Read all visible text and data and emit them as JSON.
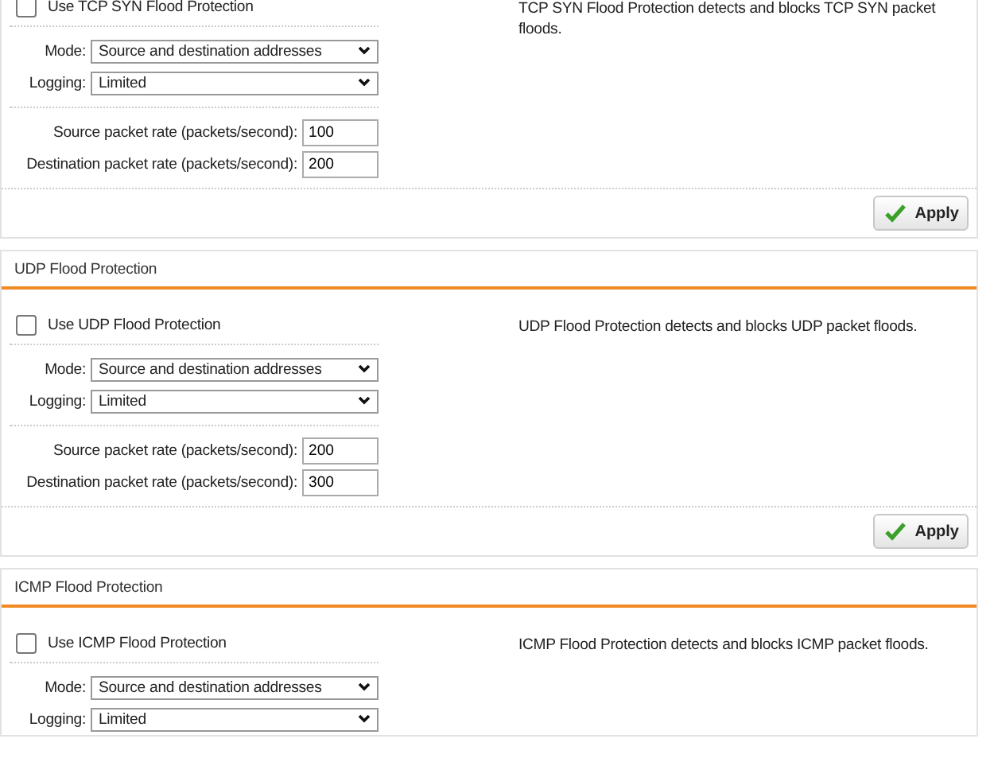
{
  "sections": [
    {
      "checkbox": {
        "label": "Use TCP SYN Flood Protection",
        "checked": false
      },
      "description": "TCP SYN Flood Protection detects and blocks TCP SYN packet floods.",
      "mode": {
        "label": "Mode:",
        "value": "Source and destination addresses"
      },
      "logging": {
        "label": "Logging:",
        "value": "Limited"
      },
      "rates": [
        {
          "label": "Source packet rate (packets/second):",
          "value": "100"
        },
        {
          "label": "Destination packet rate (packets/second):",
          "value": "200"
        }
      ],
      "apply": "Apply"
    },
    {
      "title": "UDP Flood Protection",
      "checkbox": {
        "label": "Use UDP Flood Protection",
        "checked": false
      },
      "description": "UDP Flood Protection detects and blocks UDP packet floods.",
      "mode": {
        "label": "Mode:",
        "value": "Source and destination addresses"
      },
      "logging": {
        "label": "Logging:",
        "value": "Limited"
      },
      "rates": [
        {
          "label": "Source packet rate (packets/second):",
          "value": "200"
        },
        {
          "label": "Destination packet rate (packets/second):",
          "value": "300"
        }
      ],
      "apply": "Apply"
    },
    {
      "title": "ICMP Flood Protection",
      "checkbox": {
        "label": "Use ICMP Flood Protection",
        "checked": false
      },
      "description": "ICMP Flood Protection detects and blocks ICMP packet floods.",
      "mode": {
        "label": "Mode:",
        "value": "Source and destination addresses"
      },
      "logging": {
        "label": "Logging:",
        "value": "Limited"
      }
    }
  ]
}
